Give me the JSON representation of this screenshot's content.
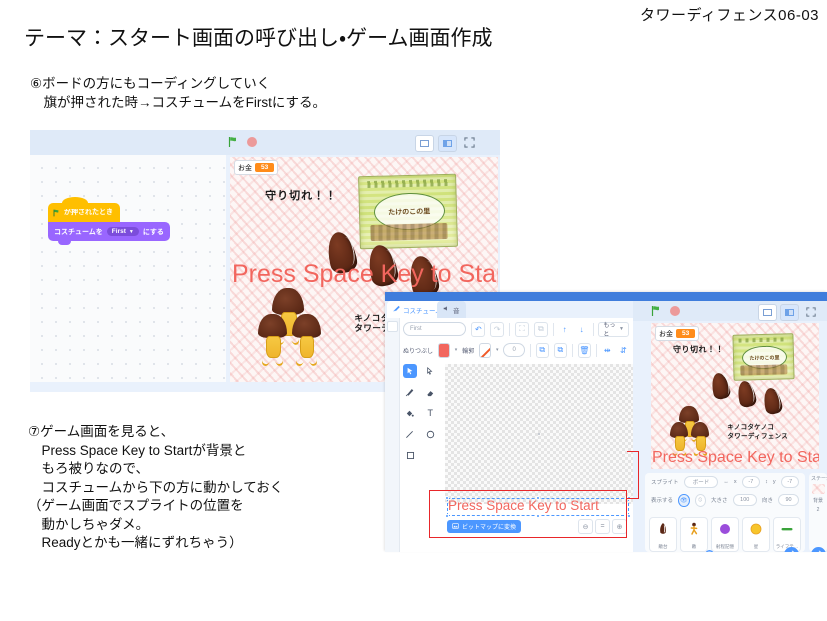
{
  "slide": {
    "code": "タワーディフェンス06-03",
    "title": "テーマ：スタート画面の呼び出し・ゲーム画面作成",
    "note6": "⑥ボードの方にもコーディングしていく\n　旗が押された時→コスチュームをFirstにする。",
    "note7": "⑦ゲーム画面を見ると、\n　Press Space Key to Startが背景と\n　もろ被りなので、\n　コスチュームから下の方に動かしておく\n（ゲーム画面でスプライトの位置を\n　動かしちゃダメ。\n　Readyとかも一緒にずれちゃう）"
  },
  "shot_a": {
    "monitor": {
      "label": "お金",
      "value": "53"
    },
    "blocks": {
      "hat": "が押されたとき",
      "look_prefix": "コスチュームを",
      "look_value": "First",
      "look_suffix": "にする"
    },
    "stage": {
      "headline": "守り切れ！！",
      "game_title": "キノコタケノコ\nタワーディフェンス",
      "box_label": "たけのこの里",
      "press_text": "Press Space Key to Start"
    }
  },
  "shot_b": {
    "tabs": [
      {
        "label": "コスチューム",
        "icon": "brush-icon",
        "active": true
      },
      {
        "label": "音",
        "icon": "speaker-icon",
        "active": false
      }
    ],
    "paint": {
      "costume_name": "First",
      "fill_label": "ぬりつぶし",
      "fill_color": "#f2665e",
      "stroke_label": "輪郭",
      "stroke_width": "0",
      "more_label": "もっと",
      "tools": [
        "select-icon",
        "reshape-icon",
        "brush-icon",
        "eraser-icon",
        "fill-icon",
        "text-icon",
        "line-icon",
        "circle-icon",
        "rect-icon"
      ],
      "selected_text": "Press Space Key to Start",
      "bitmap_button": "ビットマップに変換"
    },
    "stage": {
      "monitor": {
        "label": "お金",
        "value": "53"
      },
      "headline": "守り切れ！！",
      "game_title": "キノコタケノコ\nタワーディフェンス",
      "box_label": "たけのこの里",
      "press_text": "Press Space Key to Start"
    },
    "sprite_info": {
      "sprite_label": "スプライト",
      "sprite_name": "ボード",
      "x_label": "x",
      "x_value": "-7",
      "y_label": "y",
      "y_value": "-7",
      "show_label": "表示する",
      "size_label": "大きさ",
      "size_value": "100",
      "direction_label": "向き",
      "direction_value": "90"
    },
    "sprites": [
      {
        "name": "敵台",
        "icon": "takenoko-icon"
      },
      {
        "name": "敵",
        "icon": "runner-icon"
      },
      {
        "name": "射程記憶",
        "icon": "purple-dot-icon"
      },
      {
        "name": "星",
        "icon": "orange-dot-icon"
      },
      {
        "name": "ライフテ…",
        "icon": "bar-icon"
      }
    ],
    "stage_col": {
      "header": "ステージ",
      "backdrop_label": "背景",
      "backdrop_count": "2"
    }
  },
  "colors": {
    "accent": "#4c97ff",
    "annotation": "#e8262a",
    "press_text": "#f2665e",
    "money": "#ff8c1a",
    "hat_block": "#ffbf00",
    "look_block": "#9966ff"
  }
}
